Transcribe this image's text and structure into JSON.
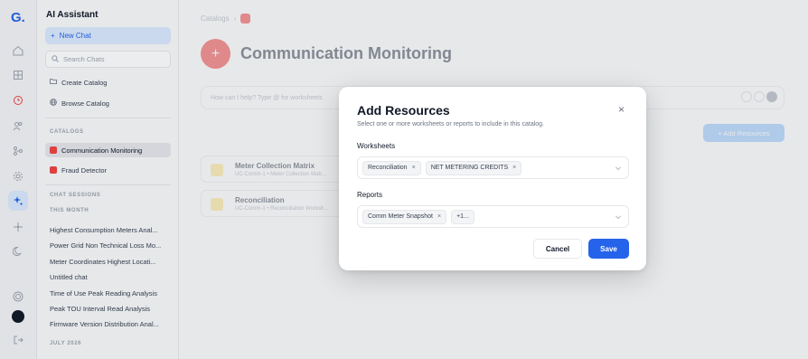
{
  "rail": {
    "logo": "G.",
    "icons": [
      "home-icon",
      "grid-icon",
      "clock-icon",
      "users-icon",
      "flow-icon",
      "settings-icon",
      "sparkles-icon",
      "move-icon",
      "moon-icon"
    ]
  },
  "sidebar": {
    "title": "AI Assistant",
    "new_chat": "New Chat",
    "search_placeholder": "Search Chats",
    "create_catalog": "Create Catalog",
    "browse_catalog": "Browse Catalog",
    "catalogs_heading": "CATALOGS",
    "catalogs": [
      "Communication Monitoring",
      "Fraud Detector"
    ],
    "sessions_heading": "CHAT SESSIONS",
    "this_month": "THIS MONTH",
    "sessions": [
      "Highest Consumption Meters Anal...",
      "Power Grid Non Technical Loss Mo...",
      "Meter Coordinates Highest Locati...",
      "Untitled chat",
      "Time of Use Peak Reading Analysis",
      "Peak TOU Interval Read Analysis",
      "Firmware Version Distribution Anal..."
    ],
    "july": "JULY 2026"
  },
  "main": {
    "breadcrumb": "Catalogs",
    "title": "Communication Monitoring",
    "prompt_placeholder": "How can I help? Type @ for worksheets",
    "add_resources": "+ Add Resources",
    "worksheets": [
      {
        "title": "Meter Collection Matrix",
        "sub": "UC-Comm-1 • Meter Collection Matr..."
      },
      {
        "title": "Reconciliation",
        "sub": "UC-Comm-1 • Reconciliation Worksh..."
      }
    ]
  },
  "modal": {
    "title": "Add Resources",
    "subtitle": "Select one or more worksheets or reports to include in this catalog.",
    "worksheets_label": "Worksheets",
    "worksheet_chips": [
      "Reconciliation",
      "NET METERING CREDITS"
    ],
    "reports_label": "Reports",
    "report_chips": [
      "Comm Meter Snapshot",
      "+1..."
    ],
    "cancel": "Cancel",
    "save": "Save"
  },
  "colors": {
    "accent": "#2563eb",
    "danger": "#ef4444"
  }
}
